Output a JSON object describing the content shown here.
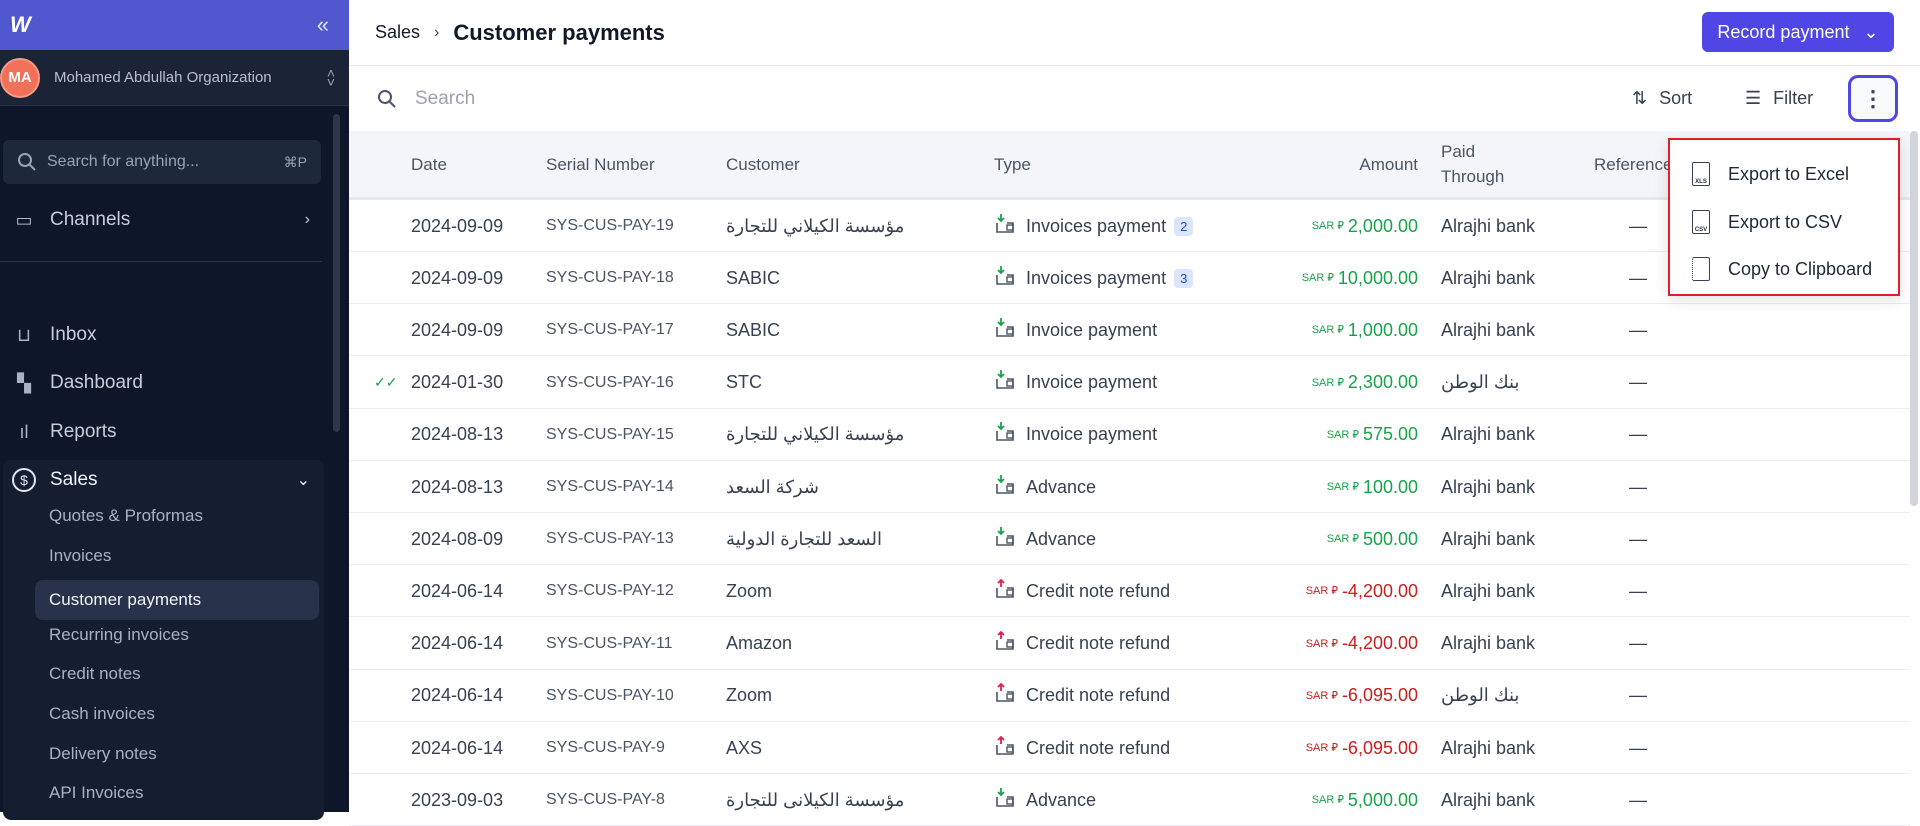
{
  "sidebar": {
    "logo": "W",
    "org": {
      "initials": "MA",
      "name": "Mohamed Abdullah Organization"
    },
    "search": {
      "placeholder": "Search for anything...",
      "shortcut": "⌘P"
    },
    "channels": "Channels",
    "items": [
      {
        "label": "Inbox"
      },
      {
        "label": "Dashboard"
      },
      {
        "label": "Reports"
      },
      {
        "label": "Sales"
      }
    ],
    "sales_sub": [
      "Quotes & Proformas",
      "Invoices",
      "Customer payments",
      "Recurring invoices",
      "Credit notes",
      "Cash invoices",
      "Delivery notes",
      "API Invoices"
    ]
  },
  "header": {
    "crumb": "Sales",
    "title": "Customer payments",
    "record_button": "Record payment"
  },
  "toolbar": {
    "search_placeholder": "Search",
    "sort": "Sort",
    "filter": "Filter"
  },
  "table": {
    "columns": {
      "date": "Date",
      "serial": "Serial Number",
      "customer": "Customer",
      "type": "Type",
      "amount": "Amount",
      "paid": "Paid Through",
      "reference": "Reference"
    },
    "currency": "SAR ⃁",
    "rows": [
      {
        "synced": false,
        "date": "2024-09-09",
        "serial": "SYS-CUS-PAY-19",
        "customer": "مؤسسة الكيلاني للتجارة",
        "type": "Invoices payment",
        "badge": "2",
        "dir": "in",
        "amount": "2,000.00",
        "neg": false,
        "paid": "Alrajhi bank",
        "ref": "—"
      },
      {
        "synced": false,
        "date": "2024-09-09",
        "serial": "SYS-CUS-PAY-18",
        "customer": "SABIC",
        "type": "Invoices payment",
        "badge": "3",
        "dir": "in",
        "amount": "10,000.00",
        "neg": false,
        "paid": "Alrajhi bank",
        "ref": "—"
      },
      {
        "synced": false,
        "date": "2024-09-09",
        "serial": "SYS-CUS-PAY-17",
        "customer": "SABIC",
        "type": "Invoice payment",
        "badge": null,
        "dir": "in",
        "amount": "1,000.00",
        "neg": false,
        "paid": "Alrajhi bank",
        "ref": "—"
      },
      {
        "synced": true,
        "date": "2024-01-30",
        "serial": "SYS-CUS-PAY-16",
        "customer": "STC",
        "type": "Invoice payment",
        "badge": null,
        "dir": "in",
        "amount": "2,300.00",
        "neg": false,
        "paid": "بنك الوطن",
        "ref": "—"
      },
      {
        "synced": false,
        "date": "2024-08-13",
        "serial": "SYS-CUS-PAY-15",
        "customer": "مؤسسة الكيلاني للتجارة",
        "type": "Invoice payment",
        "badge": null,
        "dir": "in",
        "amount": "575.00",
        "neg": false,
        "paid": "Alrajhi bank",
        "ref": "—"
      },
      {
        "synced": false,
        "date": "2024-08-13",
        "serial": "SYS-CUS-PAY-14",
        "customer": "شركة السعد",
        "type": "Advance",
        "badge": null,
        "dir": "in",
        "amount": "100.00",
        "neg": false,
        "paid": "Alrajhi bank",
        "ref": "—"
      },
      {
        "synced": false,
        "date": "2024-08-09",
        "serial": "SYS-CUS-PAY-13",
        "customer": "السعد للتجارة الدولية",
        "type": "Advance",
        "badge": null,
        "dir": "in",
        "amount": "500.00",
        "neg": false,
        "paid": "Alrajhi bank",
        "ref": "—"
      },
      {
        "synced": false,
        "date": "2024-06-14",
        "serial": "SYS-CUS-PAY-12",
        "customer": "Zoom",
        "type": "Credit note refund",
        "badge": null,
        "dir": "out",
        "amount": "-4,200.00",
        "neg": true,
        "paid": "Alrajhi bank",
        "ref": "—"
      },
      {
        "synced": false,
        "date": "2024-06-14",
        "serial": "SYS-CUS-PAY-11",
        "customer": "Amazon",
        "type": "Credit note refund",
        "badge": null,
        "dir": "out",
        "amount": "-4,200.00",
        "neg": true,
        "paid": "Alrajhi bank",
        "ref": "—"
      },
      {
        "synced": false,
        "date": "2024-06-14",
        "serial": "SYS-CUS-PAY-10",
        "customer": "Zoom",
        "type": "Credit note refund",
        "badge": null,
        "dir": "out",
        "amount": "-6,095.00",
        "neg": true,
        "paid": "بنك الوطن",
        "ref": "—"
      },
      {
        "synced": false,
        "date": "2024-06-14",
        "serial": "SYS-CUS-PAY-9",
        "customer": "AXS",
        "type": "Credit note refund",
        "badge": null,
        "dir": "out",
        "amount": "-6,095.00",
        "neg": true,
        "paid": "Alrajhi bank",
        "ref": "—"
      },
      {
        "synced": false,
        "date": "2023-09-03",
        "serial": "SYS-CUS-PAY-8",
        "customer": "مؤسسة الكيلانى للتجارة",
        "type": "Advance",
        "badge": null,
        "dir": "in",
        "amount": "5,000.00",
        "neg": false,
        "paid": "Alrajhi bank",
        "ref": "—"
      }
    ]
  },
  "menu": {
    "items": [
      {
        "label": "Export to Excel",
        "tag": "XLS"
      },
      {
        "label": "Export to CSV",
        "tag": "CSV"
      },
      {
        "label": "Copy to Clipboard"
      }
    ]
  },
  "colors": {
    "accent": "#4f46e5",
    "positive": "#16a34a",
    "negative": "#c81e1e",
    "sidebar": "#0e1629"
  }
}
